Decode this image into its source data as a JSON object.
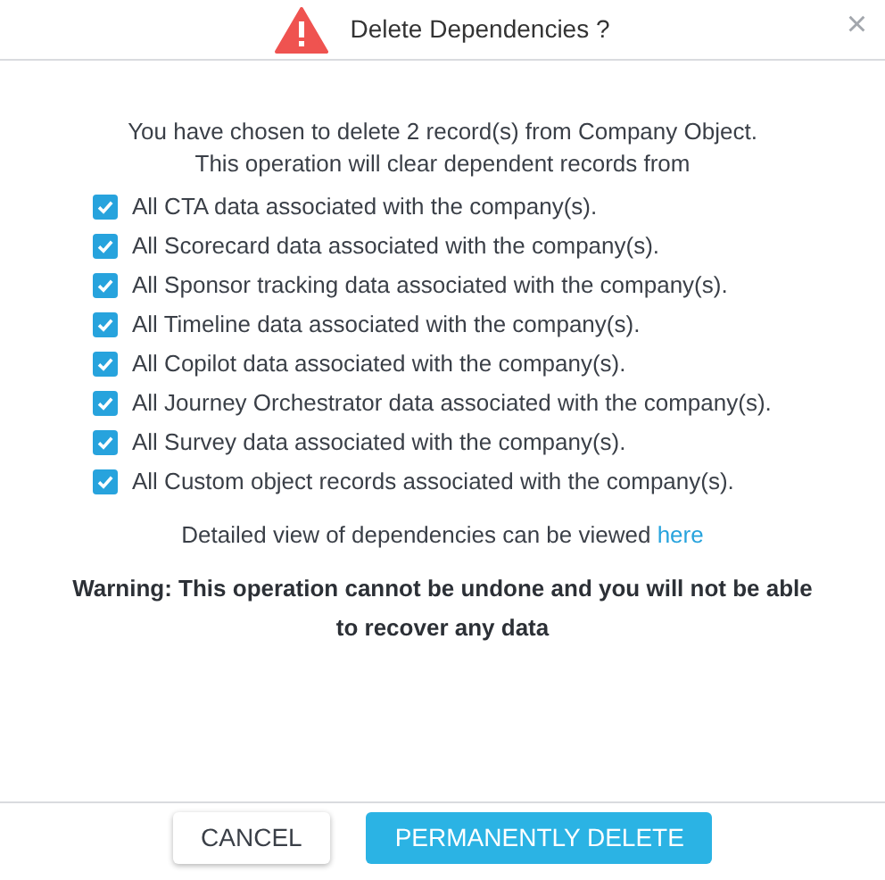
{
  "dialog": {
    "title": "Delete Dependencies ?",
    "close": "×"
  },
  "message": [
    "You have chosen to delete 2 record(s) from Company Object.",
    "This operation will clear dependent records from"
  ],
  "options": [
    {
      "label": "All CTA data associated with the company(s).",
      "checked": true
    },
    {
      "label": "All Scorecard data associated with the company(s).",
      "checked": true
    },
    {
      "label": "All Sponsor tracking data associated with the company(s).",
      "checked": true
    },
    {
      "label": "All Timeline data associated with the company(s).",
      "checked": true
    },
    {
      "label": "All Copilot data associated with the company(s).",
      "checked": true
    },
    {
      "label": "All Journey Orchestrator data associated with the company(s).",
      "checked": true
    },
    {
      "label": "All Survey data associated with the company(s).",
      "checked": true
    },
    {
      "label": "All Custom object records associated with the company(s).",
      "checked": true
    }
  ],
  "details": {
    "text": "Detailed view of dependencies can be viewed",
    "link": "here"
  },
  "warning": "Warning: This operation cannot be undone and you will not be able to recover any data",
  "buttons": [
    {
      "label": "CANCEL",
      "kind": "secondary"
    },
    {
      "label": "PERMANENTLY DELETE",
      "kind": "primary"
    }
  ]
}
